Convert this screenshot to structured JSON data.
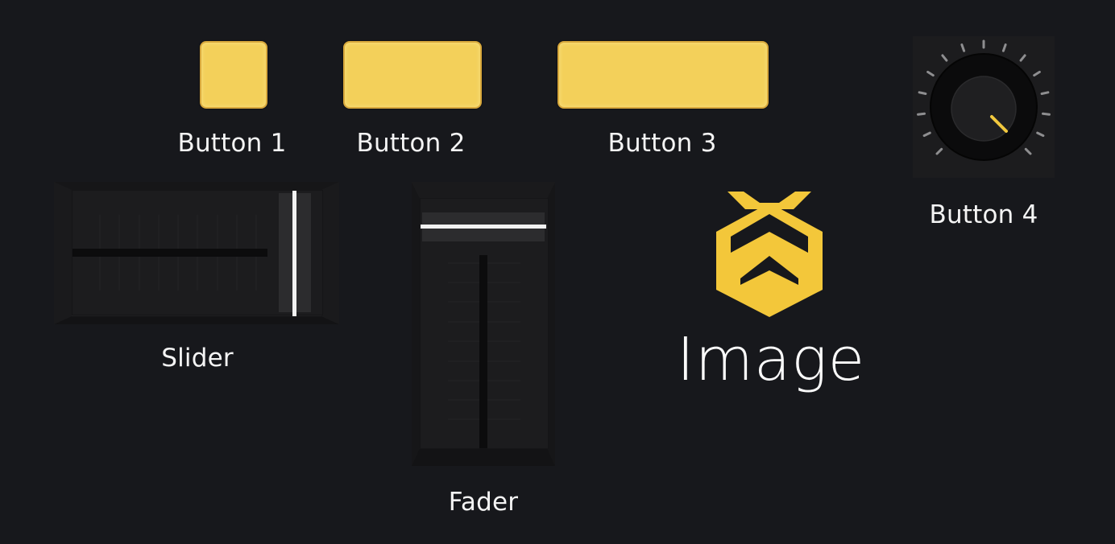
{
  "buttons": [
    {
      "label": "Button 1"
    },
    {
      "label": "Button 2"
    },
    {
      "label": "Button 3"
    }
  ],
  "knob": {
    "label": "Button 4"
  },
  "slider": {
    "label": "Slider",
    "value": 0.85
  },
  "fader": {
    "label": "Fader",
    "value": 0.85
  },
  "image": {
    "label": "Image"
  },
  "colors": {
    "background": "#17181c",
    "accent": "#f3d05a",
    "accent_border": "#d8a83c",
    "text": "#f4f4f4",
    "handle_line": "#f1f1f1"
  },
  "icons": {
    "logo": "bee-hexagon-logo-icon"
  }
}
